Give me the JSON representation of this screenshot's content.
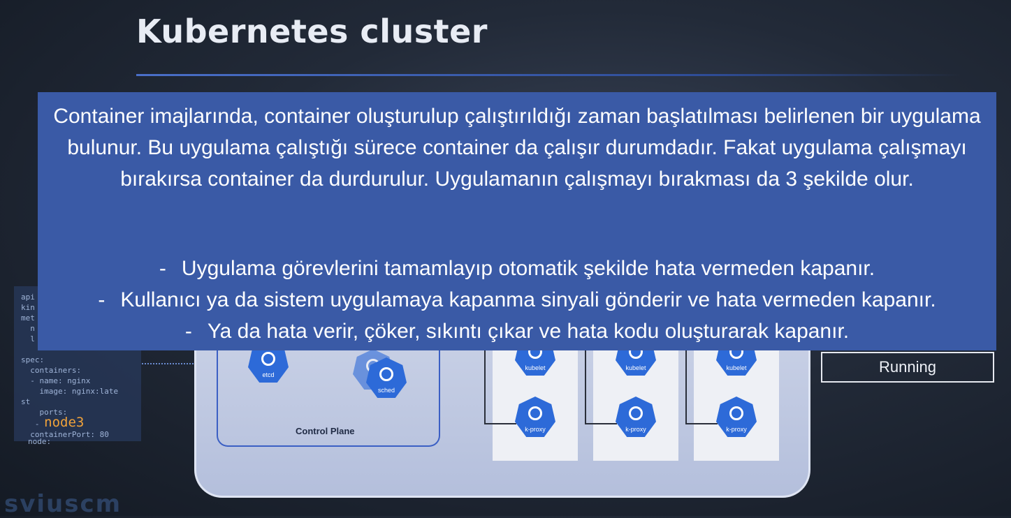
{
  "slide": {
    "title": "Kubernetes cluster",
    "watermark": "sviuscm"
  },
  "yaml": {
    "lines_hidden": [
      "api",
      "kin",
      "met",
      "  n",
      "  l"
    ],
    "spec": "spec:",
    "containers": "  containers:",
    "name_line": "  - name: nginx",
    "image_line": "    image: nginx:late",
    "image_line2": "st",
    "ports_line": "    ports:",
    "node_word": "node3",
    "container_port": "  containerPort: 80",
    "node_line": "node:"
  },
  "diagram": {
    "control_plane_label": "Control Plane",
    "cp_icons": [
      "etcd",
      "sched"
    ],
    "workers": [
      {
        "top_icon": "kubelet",
        "bottom_icon": "k-proxy"
      },
      {
        "top_icon": "kubelet",
        "bottom_icon": "k-proxy"
      },
      {
        "top_icon": "kubelet",
        "bottom_icon": "k-proxy"
      }
    ]
  },
  "status": {
    "running_label": "Running"
  },
  "caption": {
    "paragraph": "Container imajlarında, container oluşturulup çalıştırıldığı zaman başlatılması belirlenen bir uygulama bulunur. Bu uygulama çalıştığı sürece container da çalışır durumdadır. Fakat uygulama çalışmayı bırakırsa container da durdurulur. Uygulamanın çalışmayı bırakması da 3 şekilde olur.",
    "items": [
      {
        "dash": "-",
        "text": "Uygulama görevlerini tamamlayıp otomatik şekilde hata vermeden kapanır."
      },
      {
        "dash": "-",
        "text": "Kullanıcı ya da sistem uygulamaya kapanma sinyali gönderir ve hata vermeden kapanır."
      },
      {
        "dash": "-",
        "text": "Ya da hata verir, çöker, sıkıntı çıkar ve hata kodu oluşturarak kapanır."
      }
    ]
  },
  "colors": {
    "caption_bg": "#3a5aa6",
    "accent_blue": "#2d6ad8",
    "node_orange": "#f0a23a"
  }
}
